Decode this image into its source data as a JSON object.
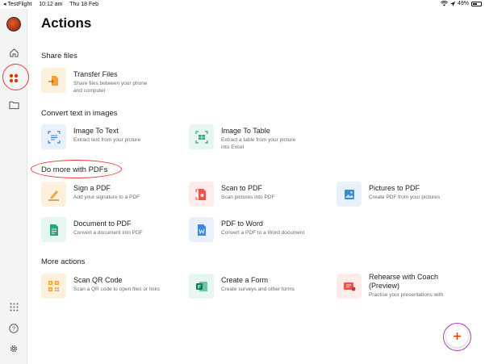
{
  "statusbar": {
    "back_app": "◂ TestFlight",
    "time": "10:12 am",
    "date": "Thu 18 Feb",
    "battery": "49%"
  },
  "sidebar": {
    "items": [
      {
        "name": "home",
        "icon": "home-icon"
      },
      {
        "name": "actions",
        "icon": "apps-grid-icon",
        "active": true
      },
      {
        "name": "files",
        "icon": "folder-icon"
      },
      {
        "name": "more",
        "icon": "dots-grid-icon"
      },
      {
        "name": "help",
        "icon": "help-icon"
      },
      {
        "name": "settings",
        "icon": "gear-icon"
      }
    ]
  },
  "page": {
    "title": "Actions"
  },
  "sections": [
    {
      "title": "Share files"
    },
    {
      "title": "Convert text in images"
    },
    {
      "title": "Do more with PDFs"
    },
    {
      "title": "More actions"
    }
  ],
  "cards": {
    "transfer": {
      "title": "Transfer Files",
      "desc1": "Share files between your phone",
      "desc2": "and computer"
    },
    "image_to_text": {
      "title": "Image To Text",
      "desc1": "Extract text from your picture"
    },
    "image_to_table": {
      "title": "Image To Table",
      "desc1": "Extract a table from your picture",
      "desc2": "into Excel"
    },
    "sign_pdf": {
      "title": "Sign a PDF",
      "desc1": "Add your signature to a PDF"
    },
    "scan_pdf": {
      "title": "Scan to PDF",
      "desc1": "Scan pictures into PDF"
    },
    "pictures_pdf": {
      "title": "Pictures to PDF",
      "desc1": "Create PDF from your pictures"
    },
    "doc_pdf": {
      "title": "Document to PDF",
      "desc1": "Convert a document into PDF"
    },
    "pdf_word": {
      "title": "PDF to Word",
      "desc1": "Convert a PDF to a Word document"
    },
    "scan_qr": {
      "title": "Scan QR Code",
      "desc1": "Scan a QR code to open files or links"
    },
    "create_form": {
      "title": "Create a Form",
      "desc1": "Create surveys and other forms"
    },
    "rehearse": {
      "title": "Rehearse with Coach",
      "title2": "(Preview)",
      "desc1": "Practise your presentations with"
    }
  },
  "colors": {
    "accent": "#d83b01",
    "annotation": "#e53935",
    "orange_bg": "#fdf0dc",
    "teal_bg": "#e6f6f2",
    "blue_bg": "#e8f1fb",
    "red_bg": "#fdecea"
  }
}
